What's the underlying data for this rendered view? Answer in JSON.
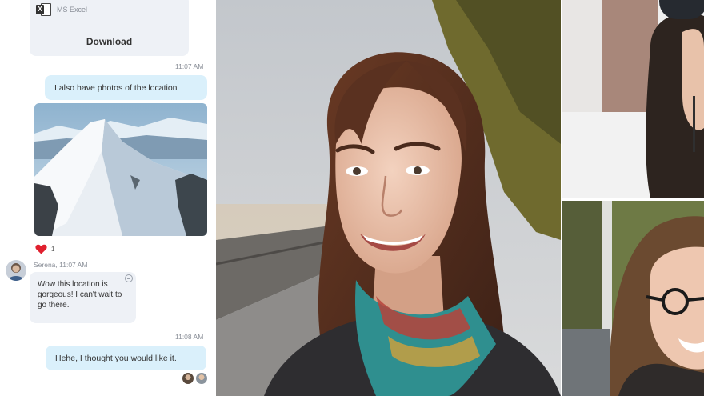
{
  "chat": {
    "file": {
      "type_label": "MS Excel",
      "icon": "excel-file-icon",
      "download_label": "Download"
    },
    "messages": [
      {
        "time": "11:07 AM",
        "text": "I also have photos of the location",
        "direction": "outgoing"
      },
      {
        "time": "",
        "text": "",
        "direction": "outgoing",
        "attachment": "photo-snowy-mountain"
      },
      {
        "reaction_icon": "heart-icon",
        "reaction_count": "1"
      },
      {
        "meta": "Serena, 11:07 AM",
        "text": "Wow this location is gorgeous! I can't wait to go there.",
        "direction": "incoming"
      },
      {
        "time": "11:08 AM",
        "text": "Hehe, I thought you would like it.",
        "direction": "outgoing"
      }
    ],
    "colors": {
      "outgoing_bubble": "#daf0fb",
      "incoming_bubble": "#eef1f6",
      "reaction": "#e0202e"
    }
  },
  "video": {
    "tiles": [
      "main-participant-video",
      "participant-video-top-right",
      "participant-video-bottom-right"
    ]
  }
}
